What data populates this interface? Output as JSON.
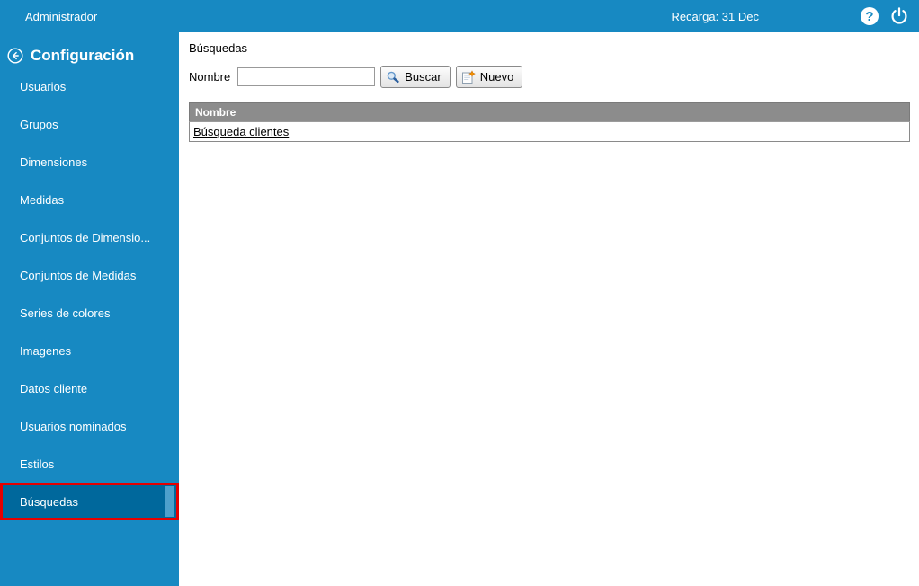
{
  "colors": {
    "primary_blue": "#1789c2",
    "selected_item_blue": "#00689c",
    "selection_highlight_red": "#e60000",
    "table_header_gray": "#8c8c8c"
  },
  "topbar": {
    "user_label": "Administrador",
    "reload_label": "Recarga: 31 Dec",
    "help_icon_glyph": "?"
  },
  "sidebar": {
    "title": "Configuración",
    "items": [
      {
        "id": "usuarios",
        "label": "Usuarios",
        "selected": false
      },
      {
        "id": "grupos",
        "label": "Grupos",
        "selected": false
      },
      {
        "id": "dimensiones",
        "label": "Dimensiones",
        "selected": false
      },
      {
        "id": "medidas",
        "label": "Medidas",
        "selected": false
      },
      {
        "id": "conjuntos-de-dimensiones",
        "label": "Conjuntos de Dimensio...",
        "selected": false
      },
      {
        "id": "conjuntos-de-medidas",
        "label": "Conjuntos de Medidas",
        "selected": false
      },
      {
        "id": "series-de-colores",
        "label": "Series de colores",
        "selected": false
      },
      {
        "id": "imagenes",
        "label": "Imagenes",
        "selected": false
      },
      {
        "id": "datos-cliente",
        "label": "Datos cliente",
        "selected": false
      },
      {
        "id": "usuarios-nominados",
        "label": "Usuarios nominados",
        "selected": false
      },
      {
        "id": "estilos",
        "label": "Estilos",
        "selected": false
      },
      {
        "id": "busquedas",
        "label": "Búsquedas",
        "selected": true
      }
    ]
  },
  "main": {
    "title": "Búsquedas",
    "form": {
      "name_label": "Nombre",
      "name_value": "",
      "search_button_label": "Buscar",
      "new_button_label": "Nuevo"
    },
    "table": {
      "columns": [
        "Nombre"
      ],
      "rows": [
        {
          "name": "Búsqueda clientes"
        }
      ]
    }
  }
}
